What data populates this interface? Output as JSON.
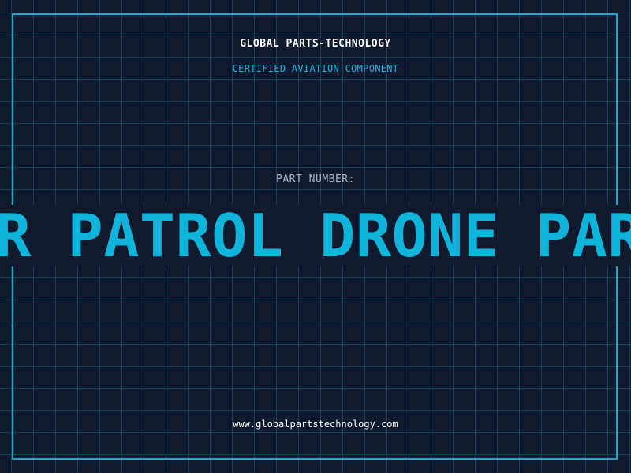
{
  "header": {
    "company": "GLOBAL PARTS-TECHNOLOGY",
    "tagline": "CERTIFIED AVIATION COMPONENT"
  },
  "part": {
    "label": "PART NUMBER:",
    "scrolling_text": "PAR PATROL DRONE PAR"
  },
  "footer": {
    "website": "www.globalpartstechnology.com"
  },
  "colors": {
    "background": "#101a2e",
    "frame": "#1aa9d0",
    "accent": "#0fb4da"
  }
}
